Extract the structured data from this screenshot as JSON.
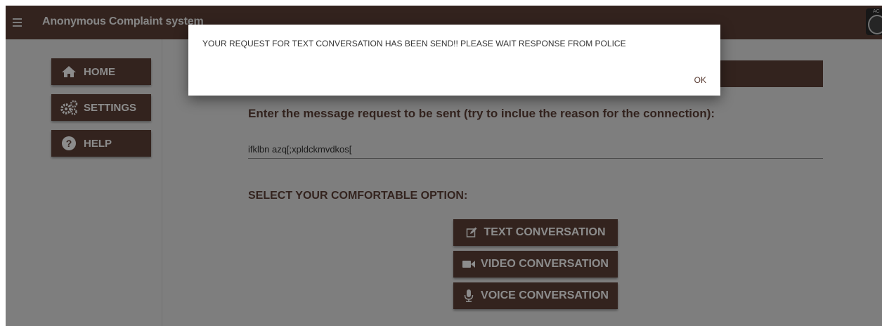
{
  "app": {
    "title": "Anonymous Complaint system",
    "avatar_text": "AC"
  },
  "sidebar": {
    "items": [
      {
        "label": "HOME",
        "icon": "home-icon"
      },
      {
        "label": "SETTINGS",
        "icon": "gears-icon"
      },
      {
        "label": "HELP",
        "icon": "help-icon"
      }
    ]
  },
  "main": {
    "prompt": "Enter the message request to be sent (try to inclue the reason for the connection):",
    "message_value": "ifklbn azq[;xpldckmvdkos[",
    "option_label": "SELECT YOUR COMFORTABLE OPTION:",
    "buttons": [
      {
        "label": "TEXT CONVERSATION",
        "icon": "edit-icon"
      },
      {
        "label": "VIDEO CONVERSATION",
        "icon": "video-camera-icon"
      },
      {
        "label": "VOICE CONVERSATION",
        "icon": "microphone-icon"
      }
    ]
  },
  "dialog": {
    "message": "YOUR REQUEST FOR TEXT CONVERSATION HAS BEEN SEND!! PLEASE WAIT RESPONSE FROM POLICE",
    "ok_label": "OK"
  },
  "colors": {
    "brand": "#5d4037",
    "background": "#e6e6e6",
    "overlay": "rgba(0,0,0,0.45)"
  }
}
